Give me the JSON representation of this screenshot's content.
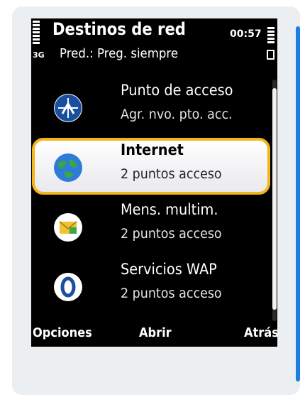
{
  "header": {
    "title": "Destinos de red",
    "clock": "00:57",
    "network": "3G",
    "subtitle": "Pred.: Preg. siempre"
  },
  "list": {
    "items": [
      {
        "label": "Punto de acceso",
        "sub": "Agr. nvo. pto. acc.",
        "icon": "access-point-icon",
        "selected": false
      },
      {
        "label": "Internet",
        "sub": "2 puntos acceso",
        "icon": "globe-icon",
        "selected": true
      },
      {
        "label": "Mens. multim.",
        "sub": "2 puntos acceso",
        "icon": "mms-envelope-icon",
        "selected": false
      },
      {
        "label": "Servicios WAP",
        "sub": "2 puntos acceso",
        "icon": "wap-zero-icon",
        "selected": false
      }
    ]
  },
  "softkeys": {
    "left": "Opciones",
    "middle": "Abrir",
    "right": "Atrás"
  },
  "colors": {
    "highlight_border": "#f2b51b",
    "accent": "#1e7fe0",
    "screen_bg": "#000000"
  }
}
